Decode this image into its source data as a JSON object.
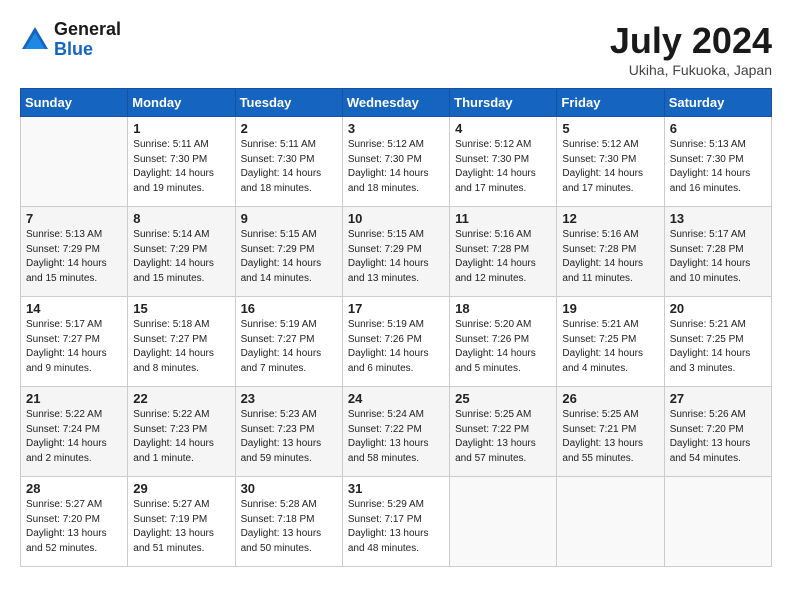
{
  "header": {
    "logo_general": "General",
    "logo_blue": "Blue",
    "title": "July 2024",
    "location": "Ukiha, Fukuoka, Japan"
  },
  "weekdays": [
    "Sunday",
    "Monday",
    "Tuesday",
    "Wednesday",
    "Thursday",
    "Friday",
    "Saturday"
  ],
  "weeks": [
    [
      {
        "day": "",
        "info": ""
      },
      {
        "day": "1",
        "info": "Sunrise: 5:11 AM\nSunset: 7:30 PM\nDaylight: 14 hours\nand 19 minutes."
      },
      {
        "day": "2",
        "info": "Sunrise: 5:11 AM\nSunset: 7:30 PM\nDaylight: 14 hours\nand 18 minutes."
      },
      {
        "day": "3",
        "info": "Sunrise: 5:12 AM\nSunset: 7:30 PM\nDaylight: 14 hours\nand 18 minutes."
      },
      {
        "day": "4",
        "info": "Sunrise: 5:12 AM\nSunset: 7:30 PM\nDaylight: 14 hours\nand 17 minutes."
      },
      {
        "day": "5",
        "info": "Sunrise: 5:12 AM\nSunset: 7:30 PM\nDaylight: 14 hours\nand 17 minutes."
      },
      {
        "day": "6",
        "info": "Sunrise: 5:13 AM\nSunset: 7:30 PM\nDaylight: 14 hours\nand 16 minutes."
      }
    ],
    [
      {
        "day": "7",
        "info": "Sunrise: 5:13 AM\nSunset: 7:29 PM\nDaylight: 14 hours\nand 15 minutes."
      },
      {
        "day": "8",
        "info": "Sunrise: 5:14 AM\nSunset: 7:29 PM\nDaylight: 14 hours\nand 15 minutes."
      },
      {
        "day": "9",
        "info": "Sunrise: 5:15 AM\nSunset: 7:29 PM\nDaylight: 14 hours\nand 14 minutes."
      },
      {
        "day": "10",
        "info": "Sunrise: 5:15 AM\nSunset: 7:29 PM\nDaylight: 14 hours\nand 13 minutes."
      },
      {
        "day": "11",
        "info": "Sunrise: 5:16 AM\nSunset: 7:28 PM\nDaylight: 14 hours\nand 12 minutes."
      },
      {
        "day": "12",
        "info": "Sunrise: 5:16 AM\nSunset: 7:28 PM\nDaylight: 14 hours\nand 11 minutes."
      },
      {
        "day": "13",
        "info": "Sunrise: 5:17 AM\nSunset: 7:28 PM\nDaylight: 14 hours\nand 10 minutes."
      }
    ],
    [
      {
        "day": "14",
        "info": "Sunrise: 5:17 AM\nSunset: 7:27 PM\nDaylight: 14 hours\nand 9 minutes."
      },
      {
        "day": "15",
        "info": "Sunrise: 5:18 AM\nSunset: 7:27 PM\nDaylight: 14 hours\nand 8 minutes."
      },
      {
        "day": "16",
        "info": "Sunrise: 5:19 AM\nSunset: 7:27 PM\nDaylight: 14 hours\nand 7 minutes."
      },
      {
        "day": "17",
        "info": "Sunrise: 5:19 AM\nSunset: 7:26 PM\nDaylight: 14 hours\nand 6 minutes."
      },
      {
        "day": "18",
        "info": "Sunrise: 5:20 AM\nSunset: 7:26 PM\nDaylight: 14 hours\nand 5 minutes."
      },
      {
        "day": "19",
        "info": "Sunrise: 5:21 AM\nSunset: 7:25 PM\nDaylight: 14 hours\nand 4 minutes."
      },
      {
        "day": "20",
        "info": "Sunrise: 5:21 AM\nSunset: 7:25 PM\nDaylight: 14 hours\nand 3 minutes."
      }
    ],
    [
      {
        "day": "21",
        "info": "Sunrise: 5:22 AM\nSunset: 7:24 PM\nDaylight: 14 hours\nand 2 minutes."
      },
      {
        "day": "22",
        "info": "Sunrise: 5:22 AM\nSunset: 7:23 PM\nDaylight: 14 hours\nand 1 minute."
      },
      {
        "day": "23",
        "info": "Sunrise: 5:23 AM\nSunset: 7:23 PM\nDaylight: 13 hours\nand 59 minutes."
      },
      {
        "day": "24",
        "info": "Sunrise: 5:24 AM\nSunset: 7:22 PM\nDaylight: 13 hours\nand 58 minutes."
      },
      {
        "day": "25",
        "info": "Sunrise: 5:25 AM\nSunset: 7:22 PM\nDaylight: 13 hours\nand 57 minutes."
      },
      {
        "day": "26",
        "info": "Sunrise: 5:25 AM\nSunset: 7:21 PM\nDaylight: 13 hours\nand 55 minutes."
      },
      {
        "day": "27",
        "info": "Sunrise: 5:26 AM\nSunset: 7:20 PM\nDaylight: 13 hours\nand 54 minutes."
      }
    ],
    [
      {
        "day": "28",
        "info": "Sunrise: 5:27 AM\nSunset: 7:20 PM\nDaylight: 13 hours\nand 52 minutes."
      },
      {
        "day": "29",
        "info": "Sunrise: 5:27 AM\nSunset: 7:19 PM\nDaylight: 13 hours\nand 51 minutes."
      },
      {
        "day": "30",
        "info": "Sunrise: 5:28 AM\nSunset: 7:18 PM\nDaylight: 13 hours\nand 50 minutes."
      },
      {
        "day": "31",
        "info": "Sunrise: 5:29 AM\nSunset: 7:17 PM\nDaylight: 13 hours\nand 48 minutes."
      },
      {
        "day": "",
        "info": ""
      },
      {
        "day": "",
        "info": ""
      },
      {
        "day": "",
        "info": ""
      }
    ]
  ]
}
